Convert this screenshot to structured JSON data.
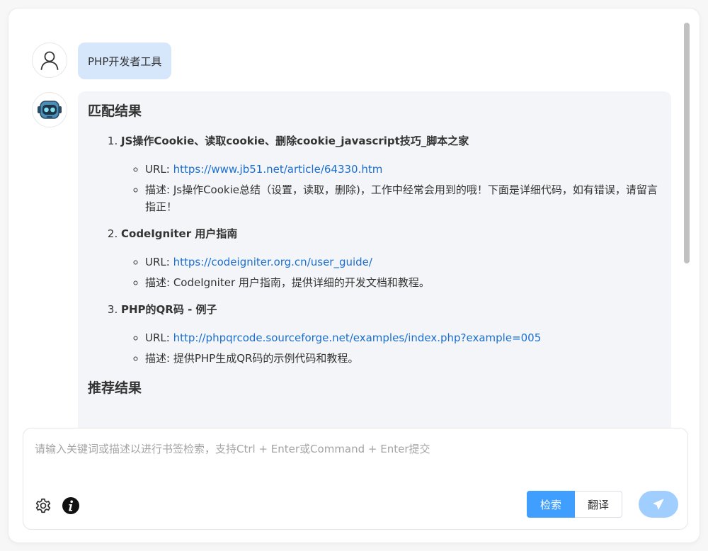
{
  "conversation": {
    "user_message": "PHP开发者工具",
    "bot_reply": {
      "match_heading": "匹配结果",
      "results": [
        {
          "title": "JS操作Cookie、读取cookie、删除cookie_javascript技巧_脚本之家",
          "url_label": "URL: ",
          "url": "https://www.jb51.net/article/64330.htm",
          "desc_label": "描述: ",
          "desc": "Js操作Cookie总结（设置，读取，删除)，工作中经常会用到的哦！下面是详细代码，如有错误，请留言指正！"
        },
        {
          "title": "CodeIgniter 用户指南",
          "url_label": "URL: ",
          "url": "https://codeigniter.org.cn/user_guide/",
          "desc_label": "描述: ",
          "desc": "CodeIgniter 用户指南，提供详细的开发文档和教程。"
        },
        {
          "title": "PHP的QR码 - 例子",
          "url_label": "URL: ",
          "url": "http://phpqrcode.sourceforge.net/examples/index.php?example=005",
          "desc_label": "描述: ",
          "desc": "提供PHP生成QR码的示例代码和教程。"
        }
      ],
      "recommend_heading": "推荐结果"
    }
  },
  "input": {
    "placeholder": "请输入关键词或描述以进行书签检索，支持Ctrl + Enter或Command + Enter提交",
    "value": ""
  },
  "modes": {
    "search_label": "检索",
    "translate_label": "翻译",
    "active": "search"
  },
  "icons": {
    "user_avatar": "user-outline-icon",
    "bot_avatar": "robot-icon",
    "settings": "gear-icon",
    "info": "info-icon",
    "send": "paper-plane-icon"
  },
  "colors": {
    "accent": "#409eff",
    "accent_light": "#a0cfff",
    "user_bubble": "#d6e6fb",
    "bot_bubble": "#f4f5f8",
    "link": "#1a6fd1"
  }
}
